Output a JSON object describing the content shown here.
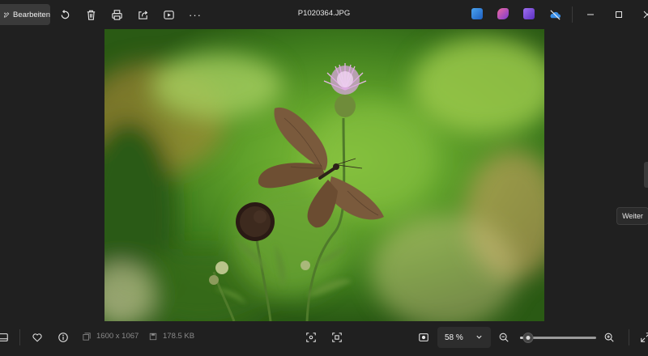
{
  "toolbar": {
    "edit_label": "Bearbeiten",
    "icons": [
      "rotate-icon",
      "delete-icon",
      "print-icon",
      "share-icon",
      "slideshow-icon",
      "more-icon"
    ],
    "more_label": "···"
  },
  "window": {
    "title": "P1020364.JPG",
    "app_icons": [
      {
        "name": "app-icon-1",
        "color": "#2f7fd8"
      },
      {
        "name": "app-icon-2",
        "color": "#c0399a"
      },
      {
        "name": "app-icon-3",
        "color": "#7b4fd6"
      },
      {
        "name": "onedrive-offline-icon",
        "color": "#3a8ee6"
      }
    ]
  },
  "navigation": {
    "next_tooltip": "Weiter"
  },
  "statusbar": {
    "dimensions": "1600 x 1067",
    "file_size": "178.5 KB",
    "zoom_value": "58 %",
    "zoom_level": 0.11
  },
  "colors": {
    "background": "#202020",
    "surface": "#2d2d2d",
    "text": "#e6e6e6",
    "muted_text": "#8a8a8a"
  }
}
